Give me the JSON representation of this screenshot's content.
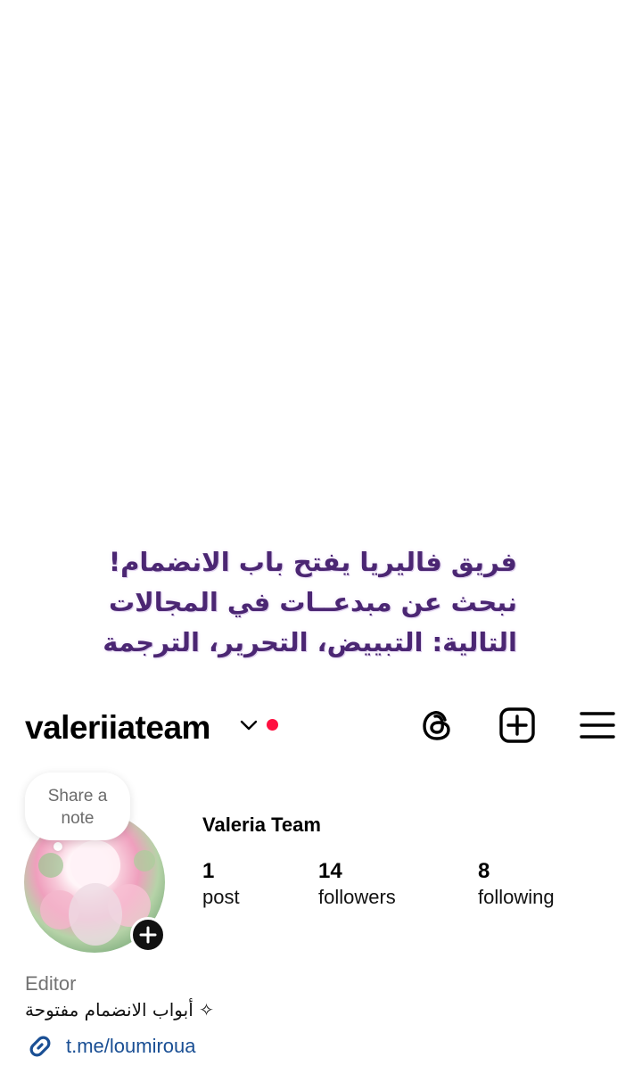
{
  "promo": {
    "line1": "فريق فاليريا يفتح باب الانضمام!",
    "line2": "نبحث عن مبدعــات في المجالات",
    "line3": "التالية: التبييض، التحرير، الترجمة"
  },
  "header": {
    "username": "valeriiateam",
    "icons": [
      "threads-icon",
      "create-post-icon",
      "menu-icon"
    ],
    "notification_dot_color": "#ff1040"
  },
  "profile": {
    "note_bubble": "Share a note",
    "display_name": "Valeria Team",
    "stats": [
      {
        "count": "1",
        "label": "post"
      },
      {
        "count": "14",
        "label": "followers"
      },
      {
        "count": "8",
        "label": "following"
      }
    ],
    "category": "Editor",
    "bio": "✧ أبواب الانضمام مفتوحة",
    "link": "t.me/loumiroua",
    "link_color": "#1a4f94"
  }
}
